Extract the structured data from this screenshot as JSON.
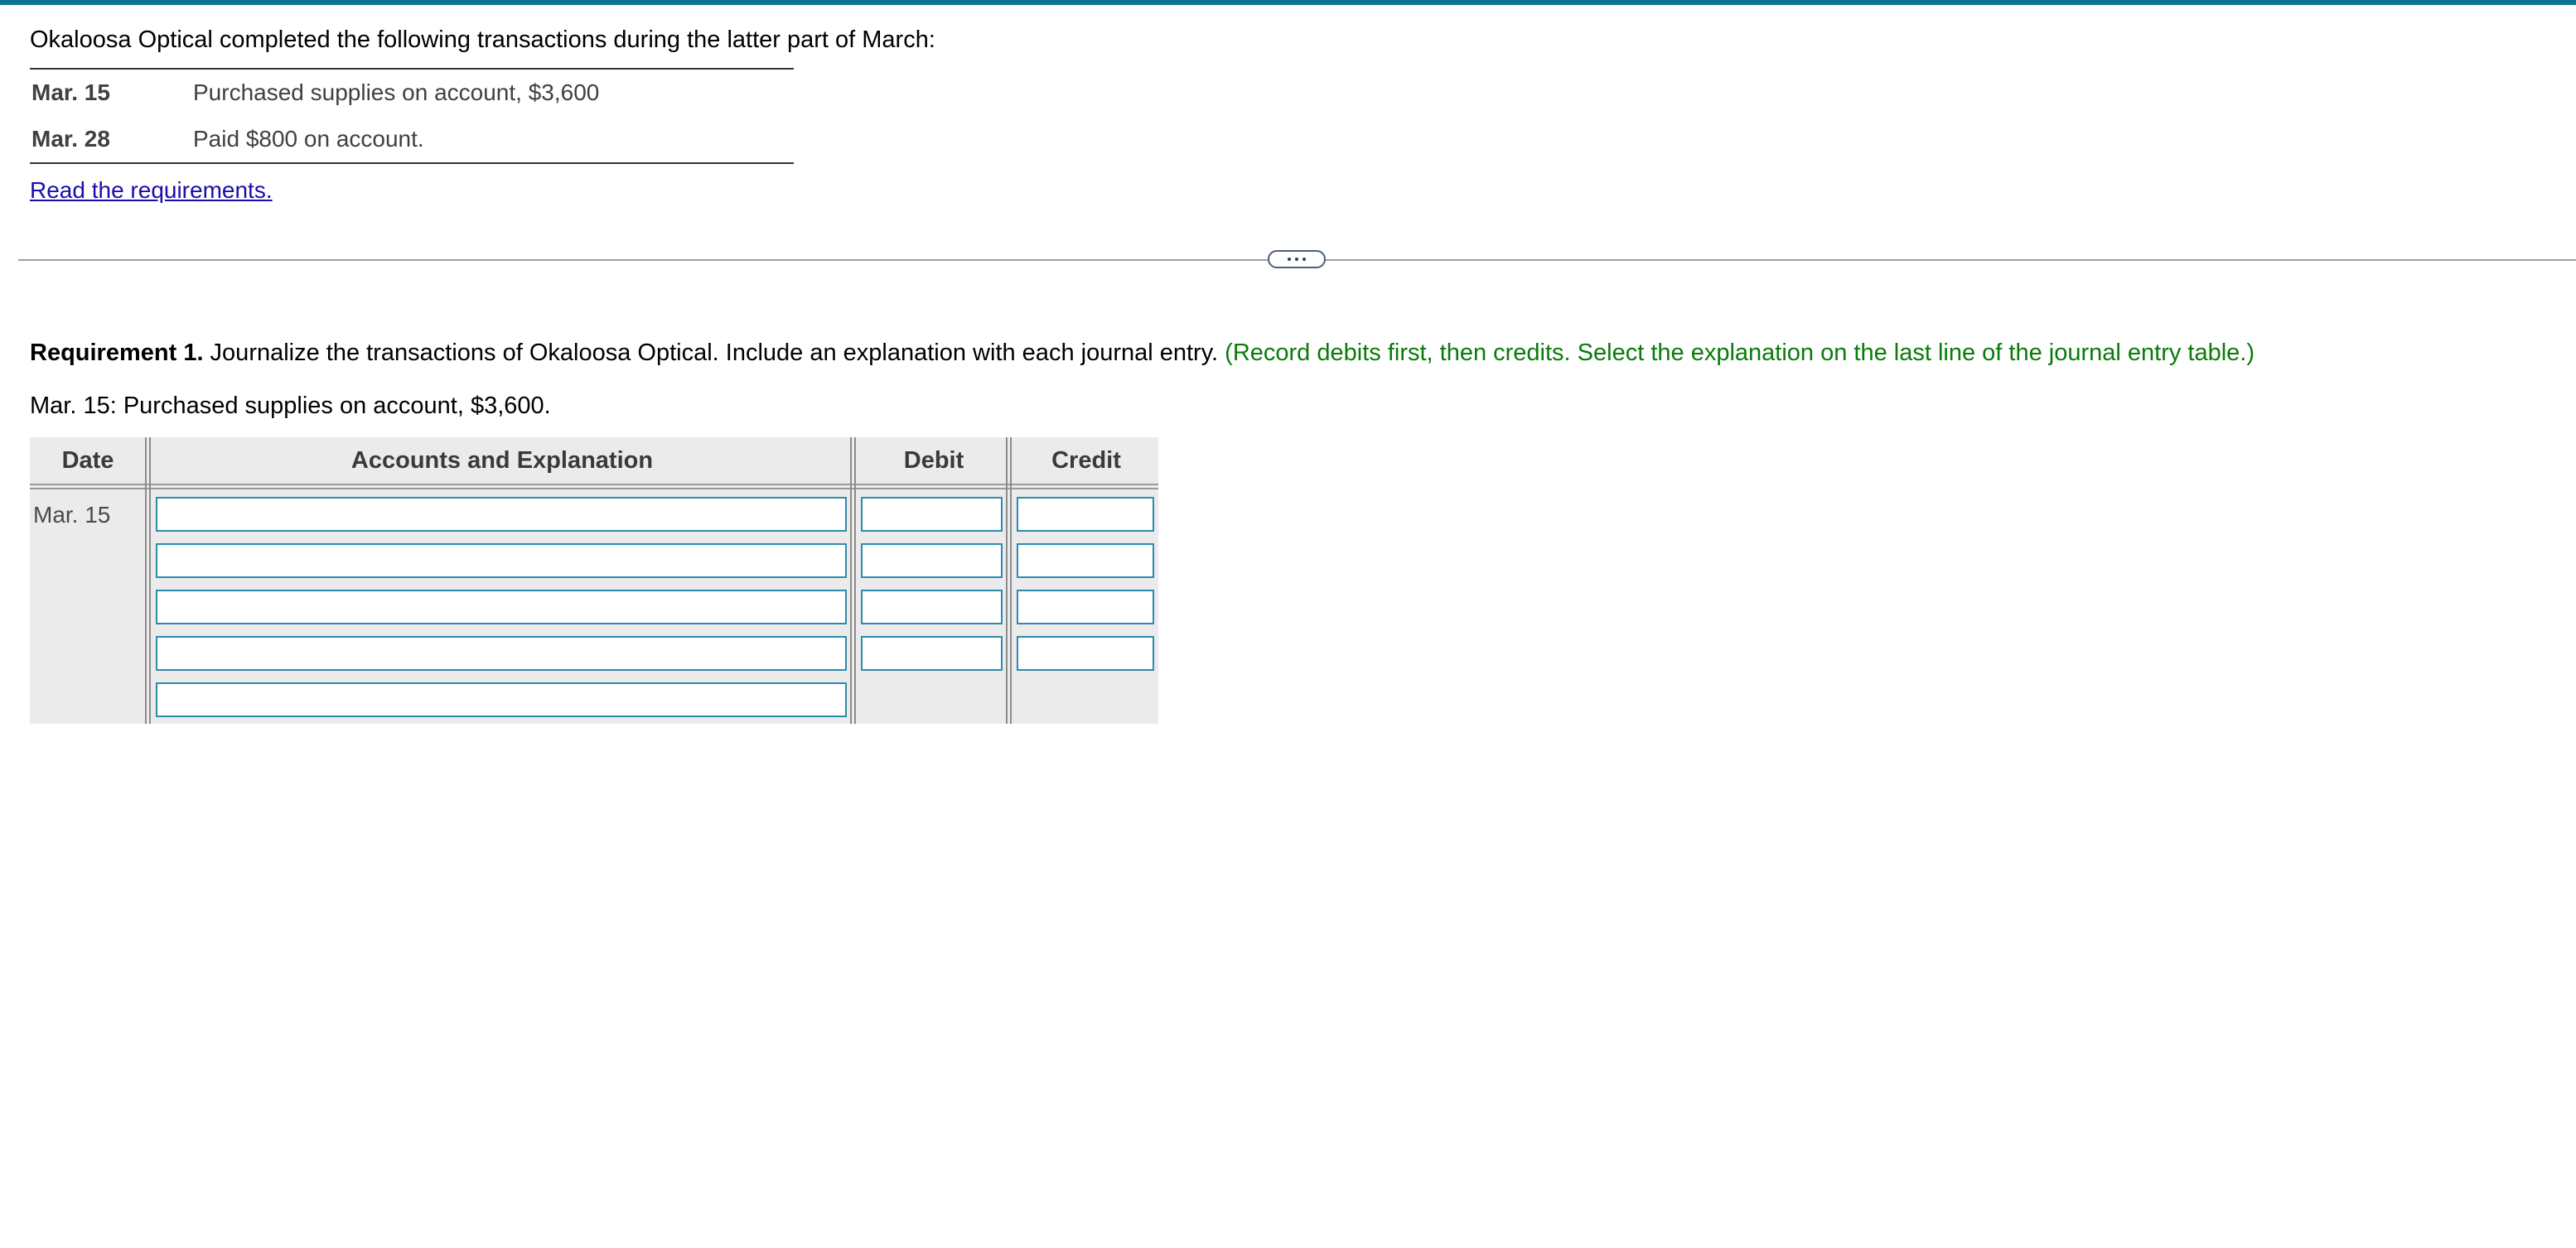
{
  "intro": "Okaloosa Optical completed the following transactions during the latter part of March:",
  "transactions": [
    {
      "date": "Mar. 15",
      "description": "Purchased supplies on account, $3,600"
    },
    {
      "date": "Mar. 28",
      "description": "Paid $800 on account."
    }
  ],
  "requirements_link": "Read the requirements.",
  "requirement": {
    "title": "Requirement 1.",
    "text": " Journalize the transactions of Okaloosa Optical. Include an explanation with each journal entry. ",
    "note": "(Record debits first, then credits. Select the explanation on the last line of the journal entry table.)"
  },
  "entry_label": "Mar. 15: Purchased supplies on account, $3,600.",
  "journal": {
    "headers": {
      "date": "Date",
      "accounts": "Accounts and Explanation",
      "debit": "Debit",
      "credit": "Credit"
    },
    "date_value": "Mar. 15",
    "rows": [
      {
        "account": "",
        "debit": "",
        "credit": ""
      },
      {
        "account": "",
        "debit": "",
        "credit": ""
      },
      {
        "account": "",
        "debit": "",
        "credit": ""
      },
      {
        "account": "",
        "debit": "",
        "credit": ""
      },
      {
        "account": ""
      }
    ]
  },
  "colors": {
    "accent_bar": "#0e7490",
    "note_green": "#0a7a0a",
    "link_blue": "#1a0dab",
    "input_border": "#2b8cae"
  }
}
